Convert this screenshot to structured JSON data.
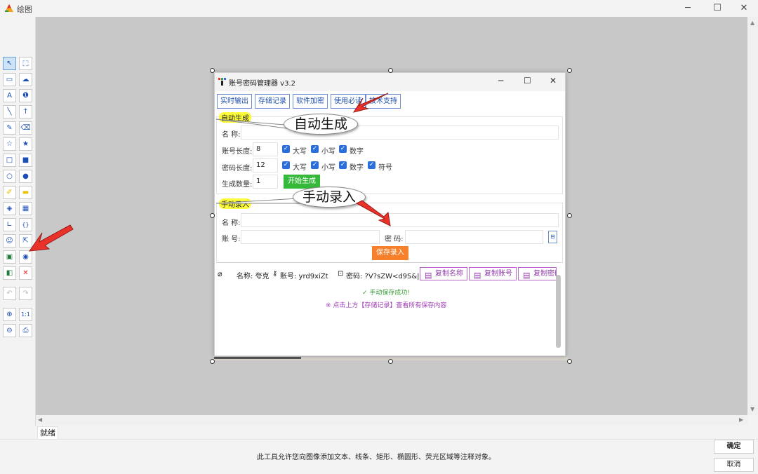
{
  "app": {
    "title": "绘图"
  },
  "window_controls": {
    "minimize": "─",
    "maximize": "☐",
    "close": "✕"
  },
  "status": {
    "text": "就绪"
  },
  "footer": {
    "hint": "此工具允许您向图像添加文本、线条、矩形、椭圆形、荧光区域等注释对象。",
    "ok": "确定",
    "cancel": "取消"
  },
  "toolbox": {
    "tools": [
      {
        "icon": "select-arrow-icon",
        "glyph": "↖"
      },
      {
        "icon": "rect-select-icon",
        "glyph": "⬚"
      },
      {
        "icon": "callout-icon",
        "glyph": "▭"
      },
      {
        "icon": "comment-icon",
        "glyph": "☁"
      },
      {
        "icon": "text-icon",
        "glyph": "A"
      },
      {
        "icon": "number-marker-icon",
        "glyph": "❶"
      },
      {
        "icon": "line-icon",
        "glyph": "╲"
      },
      {
        "icon": "arrow-icon",
        "glyph": "↑"
      },
      {
        "icon": "pencil-icon",
        "glyph": "✎"
      },
      {
        "icon": "eraser-icon",
        "glyph": "⌫"
      },
      {
        "icon": "star-outline-icon",
        "glyph": "☆"
      },
      {
        "icon": "star-filled-icon",
        "glyph": "★"
      },
      {
        "icon": "rectangle-outline-icon",
        "glyph": "□"
      },
      {
        "icon": "rectangle-filled-icon",
        "glyph": "■"
      },
      {
        "icon": "ellipse-outline-icon",
        "glyph": "○"
      },
      {
        "icon": "ellipse-filled-icon",
        "glyph": "●"
      },
      {
        "icon": "highlighter-icon",
        "glyph": "✐"
      },
      {
        "icon": "highlight-area-icon",
        "glyph": "▬"
      },
      {
        "icon": "blur-icon",
        "glyph": "◈"
      },
      {
        "icon": "mosaic-icon",
        "glyph": "▦"
      },
      {
        "icon": "corner-icon",
        "glyph": "∟"
      },
      {
        "icon": "brace-icon",
        "glyph": "{}"
      },
      {
        "icon": "emoji-icon",
        "glyph": "☺"
      },
      {
        "icon": "cursor-icon",
        "glyph": "⇱"
      },
      {
        "icon": "image-icon",
        "glyph": "▣"
      },
      {
        "icon": "target-icon",
        "glyph": "◉"
      },
      {
        "icon": "crop-icon",
        "glyph": "◧"
      },
      {
        "icon": "delete-icon",
        "glyph": "✕"
      },
      {
        "icon": "undo-icon",
        "glyph": "↶"
      },
      {
        "icon": "redo-icon",
        "glyph": "↷"
      },
      {
        "icon": "zoom-in-icon",
        "glyph": "⊕"
      },
      {
        "icon": "actual-size-icon",
        "glyph": "1:1"
      },
      {
        "icon": "zoom-out-icon",
        "glyph": "⊖"
      },
      {
        "icon": "print-icon",
        "glyph": "⎙"
      }
    ]
  },
  "inner_window": {
    "title": "账号密码管理器 v3.2",
    "tabs": [
      "实时输出",
      "存储记录",
      "软件加密",
      "使用必读",
      "技术支持"
    ],
    "auto_group": {
      "label": "自动生成",
      "name_label": "名 称:",
      "account_len_label": "账号长度:",
      "account_len_value": "8",
      "account_opts": [
        "大写",
        "小写",
        "数字"
      ],
      "password_len_label": "密码长度:",
      "password_len_value": "12",
      "password_opts": [
        "大写",
        "小写",
        "数字",
        "符号"
      ],
      "count_label": "生成数量:",
      "count_value": "1",
      "generate_button": "开始生成"
    },
    "manual_group": {
      "label": "手动录入",
      "name_label": "名 称:",
      "account_label": "账 号:",
      "password_label": "密 码:",
      "save_button": "保存录入"
    },
    "record": {
      "name": "名称: 夸克",
      "account": "账号: yrd9xiZt",
      "password": "密码: ?V?sZW<d9S&|",
      "copy_name": "复制名称",
      "copy_account": "复制账号",
      "copy_password": "复制密码"
    },
    "success_msg": "✓ 手动保存成功!",
    "tip_msg": "※ 点击上方【存储记录】查看所有保存内容"
  },
  "annotations": {
    "callout_auto": "自动生成",
    "callout_manual": "手动录入",
    "arrow_color": "#e8322a"
  }
}
